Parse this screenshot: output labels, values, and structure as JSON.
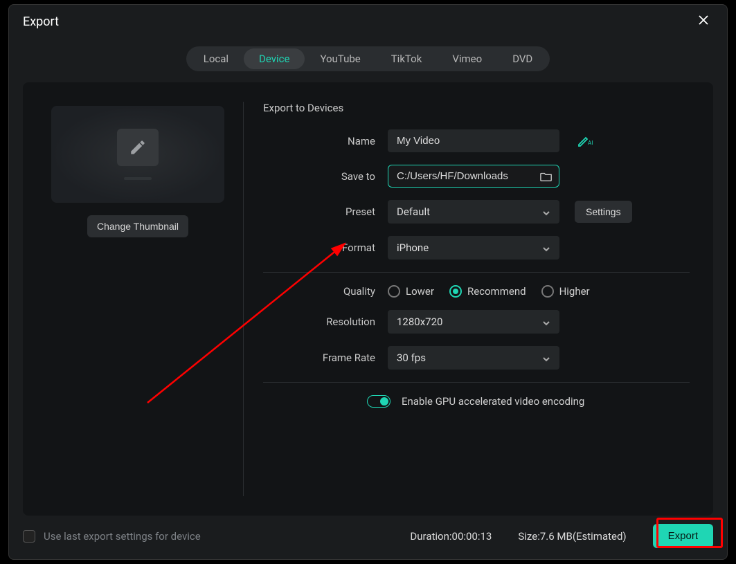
{
  "dialog": {
    "title": "Export"
  },
  "tabs": [
    {
      "label": "Local"
    },
    {
      "label": "Device"
    },
    {
      "label": "YouTube"
    },
    {
      "label": "TikTok"
    },
    {
      "label": "Vimeo"
    },
    {
      "label": "DVD"
    }
  ],
  "thumbnail": {
    "change_label": "Change Thumbnail"
  },
  "form": {
    "section_title": "Export to Devices",
    "name_label": "Name",
    "name_value": "My Video",
    "saveto_label": "Save to",
    "saveto_value": "C:/Users/HF/Downloads",
    "preset_label": "Preset",
    "preset_value": "Default",
    "settings_label": "Settings",
    "format_label": "Format",
    "format_value": "iPhone",
    "quality_label": "Quality",
    "quality_options": [
      "Lower",
      "Recommend",
      "Higher"
    ],
    "resolution_label": "Resolution",
    "resolution_value": "1280x720",
    "framerate_label": "Frame Rate",
    "framerate_value": "30 fps",
    "gpu_label": "Enable GPU accelerated video encoding"
  },
  "footer": {
    "checkbox_label": "Use last export settings for device",
    "duration_label": "Duration:",
    "duration_value": "00:00:13",
    "size_label": "Size:",
    "size_value": "7.6 MB",
    "size_suffix": "(Estimated)",
    "export_label": "Export"
  }
}
